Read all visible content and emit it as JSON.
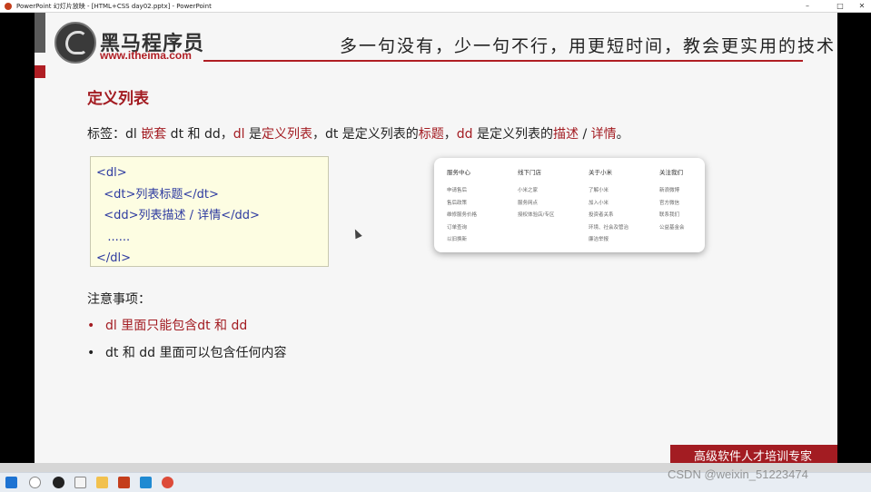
{
  "window": {
    "title": "PowerPoint 幻灯片放映 - [HTML+CSS day02.pptx] - PowerPoint",
    "min_icon": "minimize-icon",
    "max_icon": "maximize-icon",
    "close_icon": "close-icon"
  },
  "header": {
    "logo_text": "黑马程序员",
    "logo_url": "www.itheima.com",
    "slogan": "多一句没有，少一句不行，用更短时间，教会更实用的技术!"
  },
  "slide": {
    "title": "定义列表",
    "tagline_parts": [
      "标签：dl ",
      "嵌套",
      " dt 和 dd，",
      "dl",
      " 是",
      "定义列表",
      "，dt 是定义列表的",
      "标题",
      "，",
      "dd",
      " 是定义列表的",
      "描述",
      " / ",
      "详情",
      "。"
    ],
    "code_lines": [
      "<dl>",
      "  <dt>列表标题</dt>",
      "  <dd>列表描述 / 详情</dd>",
      "   ......",
      "</dl>"
    ],
    "notes_title": "注意事项：",
    "bullets": [
      {
        "dot": "•",
        "text": "dl 里面只能包含dt 和 dd"
      },
      {
        "dot": "•",
        "text": "dt 和 dd 里面可以包含任何内容"
      }
    ]
  },
  "footer_example": {
    "columns": [
      {
        "heading": "服务中心",
        "items": [
          "申请售后",
          "售后政策",
          "维修服务价格",
          "订单查询",
          "以旧换新"
        ]
      },
      {
        "heading": "线下门店",
        "items": [
          "小米之家",
          "服务网点",
          "授权体验店/专区"
        ]
      },
      {
        "heading": "关于小米",
        "items": [
          "了解小米",
          "加入小米",
          "投资者关系",
          "环境、社会及管治",
          "廉洁举报"
        ]
      },
      {
        "heading": "关注我们",
        "items": [
          "新浪微博",
          "官方微信",
          "联系我们",
          "公益基金会"
        ]
      }
    ]
  },
  "banner": {
    "text": "高级软件人才培训专家"
  },
  "watermark": {
    "text": "CSDN @weixin_51223474"
  },
  "colors": {
    "accent": "#a31c22",
    "code": "#2d3aa0",
    "code_bg": "#fdfde2"
  }
}
